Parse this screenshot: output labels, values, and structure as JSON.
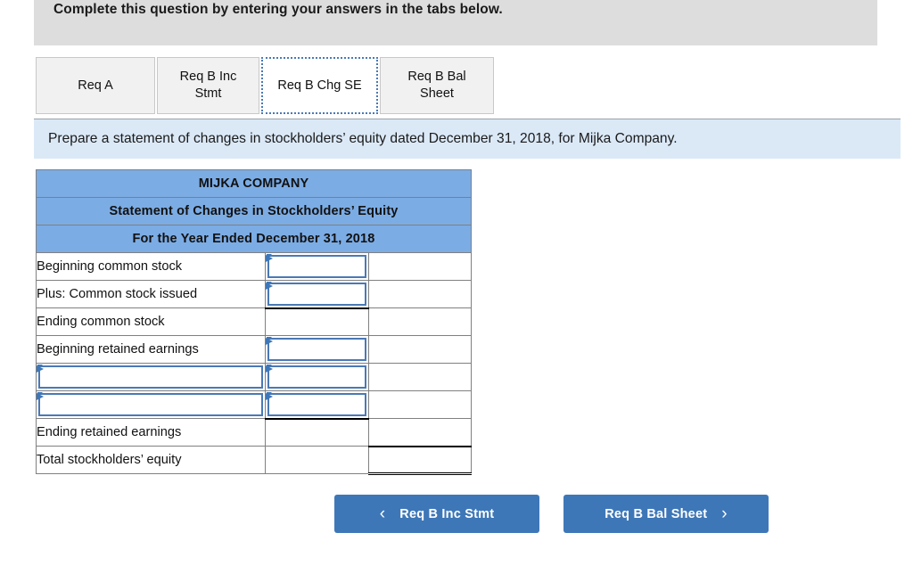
{
  "top_bar": {
    "instruction": "Complete this question by entering your answers in the tabs below."
  },
  "tabs": [
    {
      "label": "Req A",
      "active": false,
      "name": "tab-req-a"
    },
    {
      "label": "Req B Inc Stmt",
      "active": false,
      "name": "tab-req-b-inc-stmt"
    },
    {
      "label": "Req B Chg SE",
      "active": true,
      "name": "tab-req-b-chg-se"
    },
    {
      "label": "Req B Bal Sheet",
      "active": false,
      "name": "tab-req-b-bal-sheet"
    }
  ],
  "question": {
    "text": "Prepare a statement of changes in stockholders’ equity dated December 31, 2018, for Mijka Company."
  },
  "statement": {
    "header_lines": [
      "MIJKA COMPANY",
      "Statement of Changes in Stockholders’ Equity",
      "For the Year Ended December 31, 2018"
    ],
    "rows": [
      {
        "label": "Beginning common stock",
        "label_editable": false,
        "label_value": "",
        "value1": "",
        "value1_editable": true,
        "value2": "",
        "value2_editable": false
      },
      {
        "label": "Plus: Common stock issued",
        "label_editable": false,
        "label_value": "",
        "value1": "",
        "value1_editable": true,
        "value2": "",
        "value2_editable": false
      },
      {
        "label": "Ending common stock",
        "label_editable": false,
        "label_value": "",
        "value1": "",
        "value1_editable": false,
        "value2": "",
        "value2_editable": false
      },
      {
        "label": "Beginning retained earnings",
        "label_editable": false,
        "label_value": "",
        "value1": "",
        "value1_editable": true,
        "value2": "",
        "value2_editable": false
      },
      {
        "label": "",
        "label_editable": true,
        "label_value": "",
        "value1": "",
        "value1_editable": true,
        "value2": "",
        "value2_editable": false
      },
      {
        "label": "",
        "label_editable": true,
        "label_value": "",
        "value1": "",
        "value1_editable": true,
        "value2": "",
        "value2_editable": false
      },
      {
        "label": "Ending retained earnings",
        "label_editable": false,
        "label_value": "",
        "value1": "",
        "value1_editable": false,
        "value2": "",
        "value2_editable": false
      },
      {
        "label": "Total stockholders’ equity",
        "label_editable": false,
        "label_value": "",
        "value1": "",
        "value1_editable": false,
        "value2": "",
        "value2_editable": false
      }
    ]
  },
  "navigation": {
    "prev_label": "Req B Inc Stmt",
    "prev_chevron": "‹",
    "next_label": "Req B Bal Sheet",
    "next_chevron": "›"
  },
  "colors": {
    "header_blue": "#7cace4",
    "banner_blue": "#dbe9f7",
    "button_blue": "#3e77b8",
    "top_bar_gray": "#dddddd",
    "tab_gray": "#f1f1f1",
    "input_border_blue": "#4a79b5"
  }
}
